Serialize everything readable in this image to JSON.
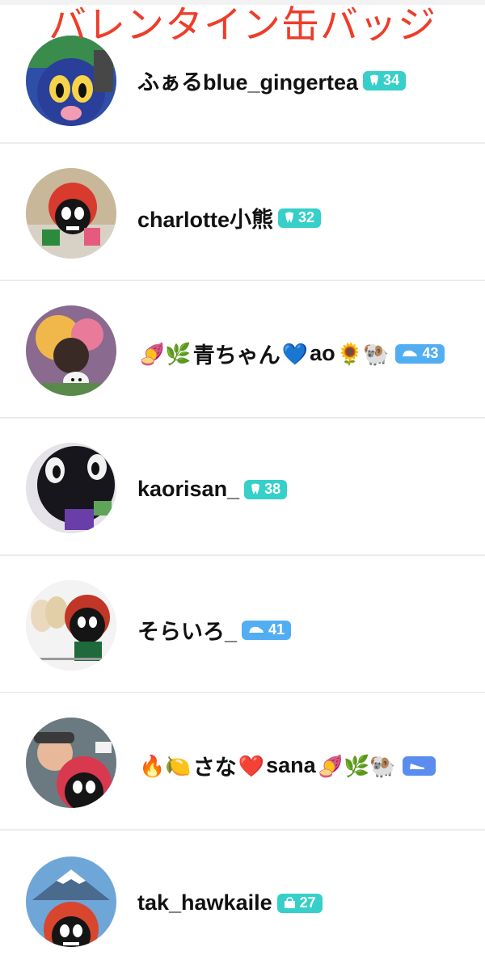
{
  "overlay_title": "バレンタイン缶バッジ",
  "colors": {
    "overlay_title": "#ee3d2a",
    "badge_teal": "#36cfc9",
    "badge_blue": "#52aef2",
    "badge_indigo": "#5b8def",
    "divider": "#ececec"
  },
  "users": [
    {
      "name": "ふぁるblue_gingertea",
      "avatar_icon": "mascot-avatar-blue-icon",
      "badge": {
        "icon": "tooth-icon",
        "color": "#36cfc9",
        "count": "34"
      }
    },
    {
      "name": "charlotte小熊",
      "avatar_icon": "mascot-avatar-red-icon",
      "badge": {
        "icon": "tooth-icon",
        "color": "#36cfc9",
        "count": "32"
      }
    },
    {
      "name_prefix": "🍠🌿",
      "name": "青ちゃん",
      "name_mid": "💙",
      "name_tail": "ao",
      "name_suffix": "🌻🐏",
      "avatar_icon": "mascot-avatar-flowers-icon",
      "badge": {
        "icon": "car-icon",
        "color": "#52aef2",
        "count": "43"
      }
    },
    {
      "name": "kaorisan_",
      "avatar_icon": "mascot-avatar-black-icon",
      "badge": {
        "icon": "tooth-icon",
        "color": "#36cfc9",
        "count": "38"
      }
    },
    {
      "name": "そらいろ_",
      "avatar_icon": "mascot-avatar-alpaca-icon",
      "badge": {
        "icon": "car-icon",
        "color": "#52aef2",
        "count": "41"
      }
    },
    {
      "name_prefix": "🔥🍋",
      "name": "さな",
      "name_mid": "❤️",
      "name_tail": "sana",
      "name_suffix": "🍠🌿🐏",
      "avatar_icon": "mascot-avatar-selfie-icon",
      "badge": {
        "icon": "shoe-icon",
        "color": "#5b8def",
        "count": ""
      }
    },
    {
      "name": "tak_hawkaile",
      "avatar_icon": "mascot-avatar-fuji-icon",
      "badge": {
        "icon": "bag-icon",
        "color": "#36cfc9",
        "count": "27"
      }
    }
  ]
}
